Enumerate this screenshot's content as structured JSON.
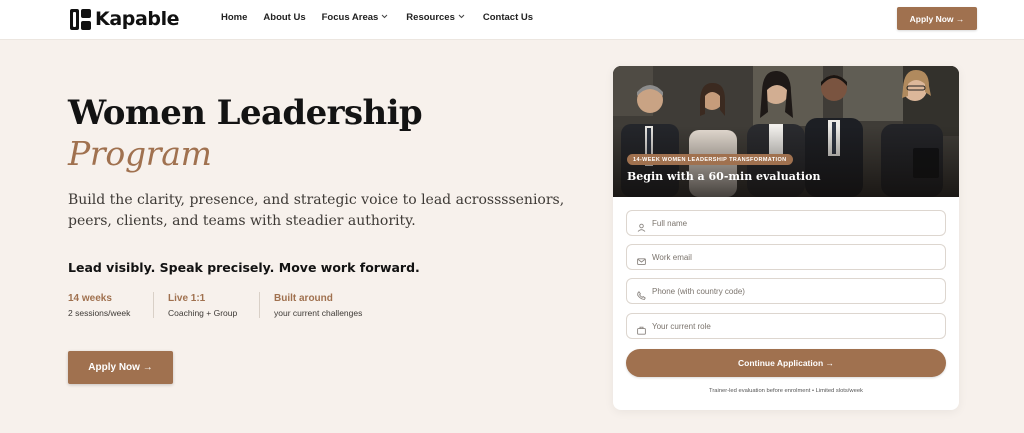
{
  "nav": {
    "brand": "Kapable",
    "links": [
      {
        "label": "Home"
      },
      {
        "label": "About Us"
      },
      {
        "label": "Focus Areas"
      },
      {
        "label": "Resources"
      },
      {
        "label": "Contact Us"
      }
    ],
    "cta_label": "Apply Now →"
  },
  "hero": {
    "title": "Women Leadership",
    "subtitle": "Program",
    "description": "Build the clarity, presence, and strategic voice to lead acrosssseniors, peers, clients, and teams with steadier authority.",
    "tagline": "Lead visibly. Speak precisely. Move work forward.",
    "stats": [
      {
        "head": "14 weeks",
        "sub": "2 sessions/week"
      },
      {
        "head": "Live 1:1",
        "sub": "Coaching + Group"
      },
      {
        "head": "Built around",
        "sub": "your current challenges"
      }
    ],
    "cta_label": "Apply Now →"
  },
  "card": {
    "badge": "14-WEEK WOMEN LEADERSHIP TRANSFORMATION",
    "heading": "Begin with a 60-min evaluation",
    "fields": {
      "name": {
        "placeholder": "Full name",
        "icon": "user-icon"
      },
      "email": {
        "placeholder": "Work email",
        "icon": "mail-icon"
      },
      "phone": {
        "placeholder": "Phone (with country code)",
        "icon": "phone-icon"
      },
      "role": {
        "placeholder": "Your current role",
        "icon": "briefcase-icon"
      }
    },
    "cta_label": "Continue Application →",
    "note": "Trainer-led evaluation before enrolment • Limited slots/week"
  },
  "colors": {
    "accent": "#a0714f",
    "background": "#f7f1ec"
  }
}
